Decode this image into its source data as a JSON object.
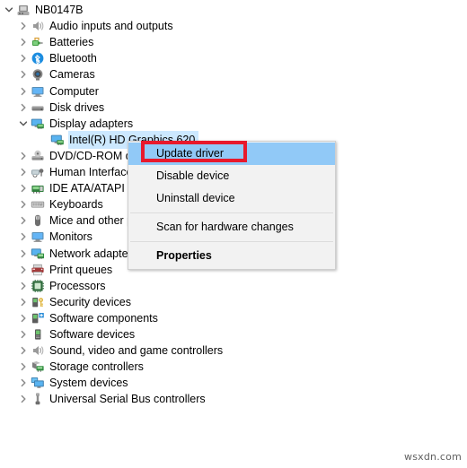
{
  "tree": {
    "root": {
      "label": "NB0147B",
      "icon": "computer-node-icon",
      "expanded": true
    },
    "items": [
      {
        "label": "Audio inputs and outputs",
        "icon": "speaker-icon",
        "level": 1,
        "expanded": false
      },
      {
        "label": "Batteries",
        "icon": "battery-icon",
        "level": 1,
        "expanded": false
      },
      {
        "label": "Bluetooth",
        "icon": "bluetooth-icon",
        "level": 1,
        "expanded": false
      },
      {
        "label": "Cameras",
        "icon": "camera-icon",
        "level": 1,
        "expanded": false
      },
      {
        "label": "Computer",
        "icon": "monitor-icon",
        "level": 1,
        "expanded": false
      },
      {
        "label": "Disk drives",
        "icon": "disk-drive-icon",
        "level": 1,
        "expanded": false
      },
      {
        "label": "Display adapters",
        "icon": "display-adapter-icon",
        "level": 1,
        "expanded": true
      },
      {
        "label": "Intel(R) HD Graphics 620",
        "icon": "display-adapter-icon",
        "level": 2,
        "expanded": null,
        "selected": true
      },
      {
        "label": "DVD/CD-ROM drives",
        "icon": "dvd-drive-icon",
        "level": 1,
        "expanded": false
      },
      {
        "label": "Human Interface Devices",
        "icon": "hid-icon",
        "level": 1,
        "expanded": false
      },
      {
        "label": "IDE ATA/ATAPI controllers",
        "icon": "ide-controller-icon",
        "level": 1,
        "expanded": false
      },
      {
        "label": "Keyboards",
        "icon": "keyboard-icon",
        "level": 1,
        "expanded": false
      },
      {
        "label": "Mice and other pointing devices",
        "icon": "mouse-icon",
        "level": 1,
        "expanded": false
      },
      {
        "label": "Monitors",
        "icon": "monitor-icon",
        "level": 1,
        "expanded": false
      },
      {
        "label": "Network adapters",
        "icon": "network-adapter-icon",
        "level": 1,
        "expanded": false
      },
      {
        "label": "Print queues",
        "icon": "printer-icon",
        "level": 1,
        "expanded": false
      },
      {
        "label": "Processors",
        "icon": "processor-icon",
        "level": 1,
        "expanded": false
      },
      {
        "label": "Security devices",
        "icon": "security-device-icon",
        "level": 1,
        "expanded": false
      },
      {
        "label": "Software components",
        "icon": "software-component-icon",
        "level": 1,
        "expanded": false
      },
      {
        "label": "Software devices",
        "icon": "software-device-icon",
        "level": 1,
        "expanded": false
      },
      {
        "label": "Sound, video and game controllers",
        "icon": "speaker-icon",
        "level": 1,
        "expanded": false
      },
      {
        "label": "Storage controllers",
        "icon": "storage-controller-icon",
        "level": 1,
        "expanded": false
      },
      {
        "label": "System devices",
        "icon": "system-device-icon",
        "level": 1,
        "expanded": false
      },
      {
        "label": "Universal Serial Bus controllers",
        "icon": "usb-icon",
        "level": 1,
        "expanded": false
      }
    ]
  },
  "context_menu": {
    "items": [
      {
        "label": "Update driver",
        "highlighted": true,
        "bold": false,
        "separator_after": false
      },
      {
        "label": "Disable device",
        "highlighted": false,
        "bold": false,
        "separator_after": false
      },
      {
        "label": "Uninstall device",
        "highlighted": false,
        "bold": false,
        "separator_after": true
      },
      {
        "label": "Scan for hardware changes",
        "highlighted": false,
        "bold": false,
        "separator_after": true
      },
      {
        "label": "Properties",
        "highlighted": false,
        "bold": true,
        "separator_after": false
      }
    ]
  },
  "annotation": {
    "color": "#e8192c",
    "target_label": "Update driver"
  },
  "watermark": {
    "text": "wsxdn.com"
  },
  "colors": {
    "selection_blue": "#cce8ff",
    "menu_highlight_blue": "#91c9f7",
    "menu_background": "#f2f2f2",
    "annotation_red": "#e8192c",
    "page_background": "#ffffff"
  }
}
